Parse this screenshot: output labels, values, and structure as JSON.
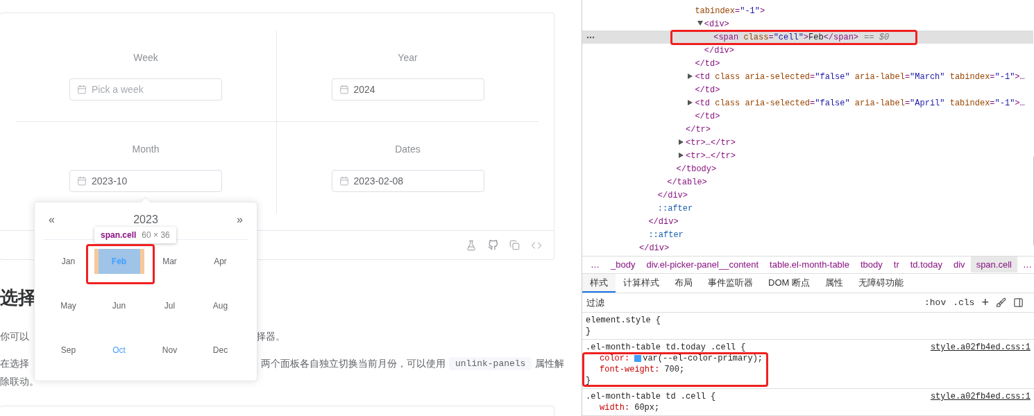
{
  "demo": {
    "fields": [
      {
        "label": "Week",
        "placeholder": "Pick a week"
      },
      {
        "label": "Year",
        "value": "2024"
      },
      {
        "label": "Month",
        "value": "2023-10"
      },
      {
        "label": "Dates",
        "value": "2023-02-08"
      }
    ]
  },
  "doc": {
    "heading": "选择",
    "paragraph_1": {
      "left": "你可以",
      "right": "择器。"
    },
    "paragraph_2": {
      "left": "在选择",
      "right": "两个面板各自独立切换当前月份，可以使用",
      "code": "unlink-panels",
      "after": "属性解",
      "line_2": "除联动。"
    }
  },
  "month_picker": {
    "prev": "«",
    "year": "2023",
    "next": "»",
    "months": [
      {
        "label": "Jan",
        "today": false,
        "selected": false,
        "inspected": false
      },
      {
        "label": "Feb",
        "today": true,
        "selected": false,
        "inspected": true
      },
      {
        "label": "Mar",
        "today": false,
        "selected": false,
        "inspected": false
      },
      {
        "label": "Apr",
        "today": false,
        "selected": false,
        "inspected": false
      },
      {
        "label": "May",
        "today": false,
        "selected": false,
        "inspected": false
      },
      {
        "label": "Jun",
        "today": false,
        "selected": false,
        "inspected": false
      },
      {
        "label": "Jul",
        "today": false,
        "selected": false,
        "inspected": false
      },
      {
        "label": "Aug",
        "today": false,
        "selected": false,
        "inspected": false
      },
      {
        "label": "Sep",
        "today": false,
        "selected": false,
        "inspected": false
      },
      {
        "label": "Oct",
        "today": false,
        "selected": true,
        "inspected": false
      },
      {
        "label": "Nov",
        "today": false,
        "selected": false,
        "inspected": false
      },
      {
        "label": "Dec",
        "today": false,
        "selected": false,
        "inspected": false
      }
    ]
  },
  "inspect_tooltip": {
    "selector": "span.cell",
    "size": "60 × 36"
  },
  "devtools": {
    "dom_tree": [
      {
        "kind": "element",
        "selected": false,
        "close": "</div>",
        "children": [
          {
            "kind": "element",
            "selected": false,
            "close": "</div>",
            "children": [
              {
                "kind": "element",
                "selected": false,
                "close": "</div>",
                "children": [
                  {
                    "kind": "element",
                    "selected": false,
                    "close": "</table>",
                    "children": [
                      {
                        "kind": "element",
                        "selected": false,
                        "close": "</tbody>",
                        "children": [
                          {
                            "kind": "element",
                            "selected": false,
                            "close": "</tr>",
                            "children": [
                              {
                                "kind": "element",
                                "selected": false,
                                "text": "tabindex=\"-1\">",
                                "close": "</td>",
                                "children": [
                                  {
                                    "kind": "element",
                                    "selected": false,
                                    "text": "<div>",
                                    "expanded": true,
                                    "close": "</div>",
                                    "children": [
                                      {
                                        "kind": "element",
                                        "selected": true,
                                        "text": "<span class=\"cell\">Feb</span>",
                                        "marker": "== $0"
                                      }
                                    ]
                                  }
                                ]
                              },
                              {
                                "kind": "element",
                                "selected": false,
                                "text": "<td class aria-selected=\"false\" aria-label=\"March\" tabindex=\"-1\">…",
                                "expanded": false,
                                "close": "</td>"
                              },
                              {
                                "kind": "element",
                                "selected": false,
                                "text": "<td class aria-selected=\"false\" aria-label=\"April\" tabindex=\"-1\">…",
                                "expanded": false,
                                "close": "</td>"
                              }
                            ]
                          },
                          {
                            "kind": "element",
                            "selected": false,
                            "text": "<tr>…</tr>",
                            "expanded": false
                          },
                          {
                            "kind": "element",
                            "selected": false,
                            "text": "<tr>…</tr>",
                            "expanded": false
                          }
                        ]
                      }
                    ]
                  }
                ]
              },
              {
                "kind": "pseudo",
                "selected": false,
                "text": "::after"
              }
            ]
          },
          {
            "kind": "pseudo",
            "selected": false,
            "text": "::after"
          }
        ]
      }
    ],
    "breadcrumb": {
      "overflow_left": "…",
      "items": [
        {
          "label": "_body",
          "selected": false
        },
        {
          "label": "div.el-picker-panel__content",
          "selected": false
        },
        {
          "label": "table.el-month-table",
          "selected": false
        },
        {
          "label": "tbody",
          "selected": false
        },
        {
          "label": "tr",
          "selected": false
        },
        {
          "label": "td.today",
          "selected": false
        },
        {
          "label": "div",
          "selected": false
        },
        {
          "label": "span.cell",
          "selected": true
        }
      ],
      "overflow_right": "…"
    },
    "tabs": [
      {
        "label": "样式",
        "selected": true
      },
      {
        "label": "计算样式",
        "selected": false
      },
      {
        "label": "布局",
        "selected": false
      },
      {
        "label": "事件监听器",
        "selected": false
      },
      {
        "label": "DOM 断点",
        "selected": false
      },
      {
        "label": "属性",
        "selected": false
      },
      {
        "label": "无障碍功能",
        "selected": false
      }
    ],
    "filter": {
      "placeholder": "过滤",
      "hov": ":hov",
      "cls": ".cls",
      "add": "+"
    },
    "rules": [
      {
        "selector": "element.style {",
        "close": "}"
      },
      {
        "selector": ".el-month-table td.today .cell {",
        "source": "style.a02fb4ed.css:1",
        "declarations": [
          {
            "property": "color:",
            "value": "var(--el-color-primary);",
            "color": "#409eff"
          },
          {
            "property": "font-weight:",
            "value": "700;"
          }
        ],
        "close": "}"
      },
      {
        "selector": ".el-month-table td .cell {",
        "source": "style.a02fb4ed.css:1",
        "declarations": [
          {
            "property": "width:",
            "value": "60px;"
          }
        ]
      }
    ]
  }
}
